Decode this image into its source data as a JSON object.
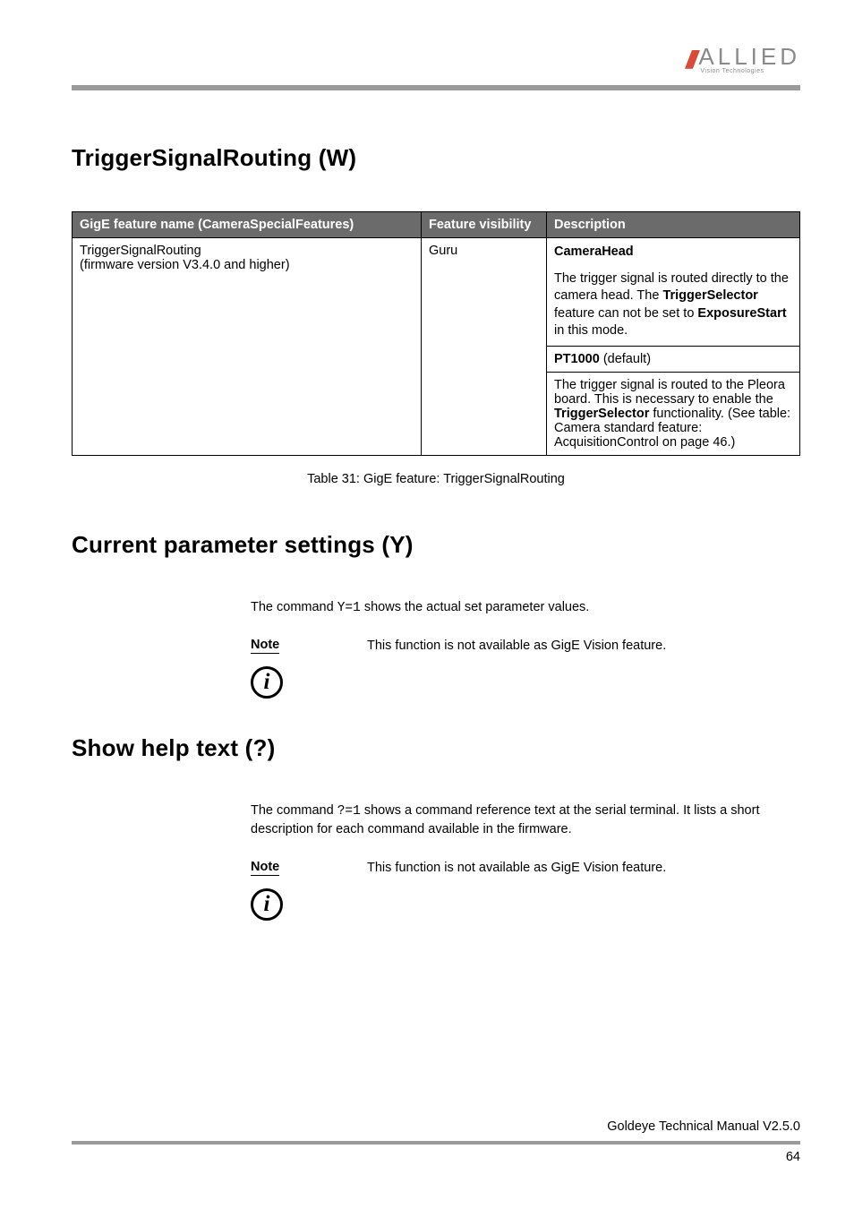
{
  "logo": {
    "slashes": "///",
    "main": "ALLIED",
    "sub": "Vision Technologies"
  },
  "sections": {
    "s1": {
      "title": "TriggerSignalRouting (W)"
    },
    "s2": {
      "title": "Current parameter settings (Y)"
    },
    "s3": {
      "title": "Show help text (?)"
    }
  },
  "table": {
    "headers": {
      "c1": "GigE feature name (CameraSpecialFeatures)",
      "c2": "Feature visibility",
      "c3": "Description"
    },
    "row": {
      "name_line1": "TriggerSignalRouting",
      "name_line2": "(firmware version V3.4.0 and higher)",
      "visibility": "Guru",
      "desc": {
        "head1": "CameraHead",
        "p1a": "The trigger signal is routed directly to the camera head. The ",
        "p1b_bold": "TriggerSelector",
        "p1c": " feature can not be set to ",
        "p1d_bold": "ExposureStart",
        "p1e": " in this mode.",
        "head2a": "PT1000",
        "head2b": " (default)",
        "p2a": "The trigger signal is routed to the Pleora board. This is necessary to enable the ",
        "p2b_bold": "TriggerSelector",
        "p2c": " functionality. (See table: Camera standard feature: AcquisitionControl on page 46.)"
      }
    },
    "caption": "Table 31: GigE feature: TriggerSignalRouting"
  },
  "body": {
    "y_pre": "The command ",
    "y_code": "Y=1",
    "y_post": " shows the actual set parameter values.",
    "q_pre": "The command ",
    "q_code": "?=1",
    "q_post": " shows a command reference text at the serial terminal. It lists a short description for each command available in the firmware."
  },
  "note": {
    "label": "Note",
    "text": "This function is not available as GigE Vision feature.",
    "icon_glyph": "i"
  },
  "footer": {
    "doc": "Goldeye Technical Manual V2.5.0",
    "page": "64"
  }
}
